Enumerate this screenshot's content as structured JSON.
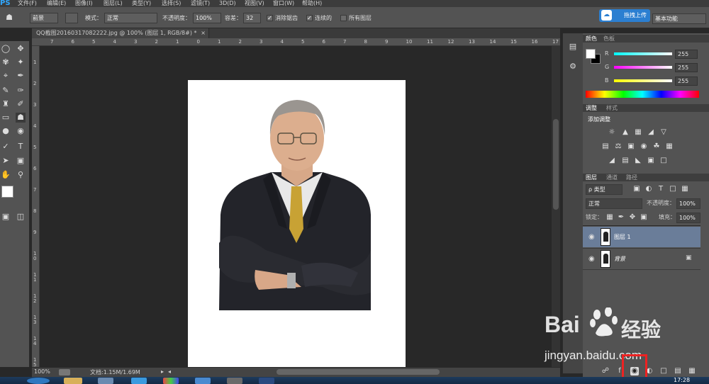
{
  "menubar": {
    "logo": "PS",
    "items": [
      "文件(F)",
      "编辑(E)",
      "图像(I)",
      "图层(L)",
      "类型(Y)",
      "选择(S)",
      "滤镜(T)",
      "3D(D)",
      "视图(V)",
      "窗口(W)",
      "帮助(H)"
    ]
  },
  "options": {
    "preset": "前景",
    "mode_label": "模式：",
    "mode_value": "正常",
    "opacity_label": "不透明度：",
    "opacity_value": "100%",
    "tolerance_label": "容差：",
    "tolerance_value": "32",
    "antialias_label": "消除锯齿",
    "contiguous_label": "连续的",
    "all_layers_label": "所有图层",
    "upload_label": "拖拽上传",
    "upload_icon": "cloud-icon",
    "workspace": "基本功能"
  },
  "document": {
    "tab_title": "QQ截图20160317082222.jpg @ 100% (图层 1, RGB/8#) *",
    "close": "×"
  },
  "rulers": {
    "h": [
      "7",
      "6",
      "5",
      "4",
      "3",
      "2",
      "1",
      "0",
      "1",
      "2",
      "3",
      "4",
      "5",
      "6",
      "7",
      "8",
      "9",
      "10",
      "11",
      "12",
      "13",
      "14",
      "15",
      "16",
      "17"
    ],
    "v": [
      "1",
      "2",
      "3",
      "4",
      "5",
      "6",
      "7",
      "8",
      "9",
      "1 0",
      "1 1",
      "1 2",
      "1 3",
      "1 4",
      "1 5"
    ]
  },
  "status": {
    "zoom": "100%",
    "doc_size": "文档:1.15M/1.69M"
  },
  "color_panel": {
    "tabs": [
      "颜色",
      "色板"
    ],
    "r_label": "R",
    "g_label": "G",
    "b_label": "B",
    "r": "255",
    "g": "255",
    "b": "255"
  },
  "adjust_panel": {
    "tabs": [
      "调整",
      "样式"
    ],
    "title": "添加调整"
  },
  "layers_panel": {
    "tabs": [
      "图层",
      "通道",
      "路径"
    ],
    "filter": "ρ 类型",
    "blend": "正常",
    "opacity_label": "不透明度：",
    "opacity": "100%",
    "lock_label": "锁定：",
    "fill_label": "填充：",
    "fill": "100%",
    "layers": [
      {
        "name": "图层 1",
        "selected": true
      },
      {
        "name": "背景",
        "locked": true
      }
    ]
  },
  "watermark": {
    "brand": "Bai",
    "brand2": "经验",
    "url": "jingyan.baidu.com"
  },
  "taskbar": {
    "time": "17:28"
  },
  "colors": {
    "accent": "#2b7fd1",
    "highlight": "#e22222",
    "selected_layer": "#6a7d99"
  }
}
